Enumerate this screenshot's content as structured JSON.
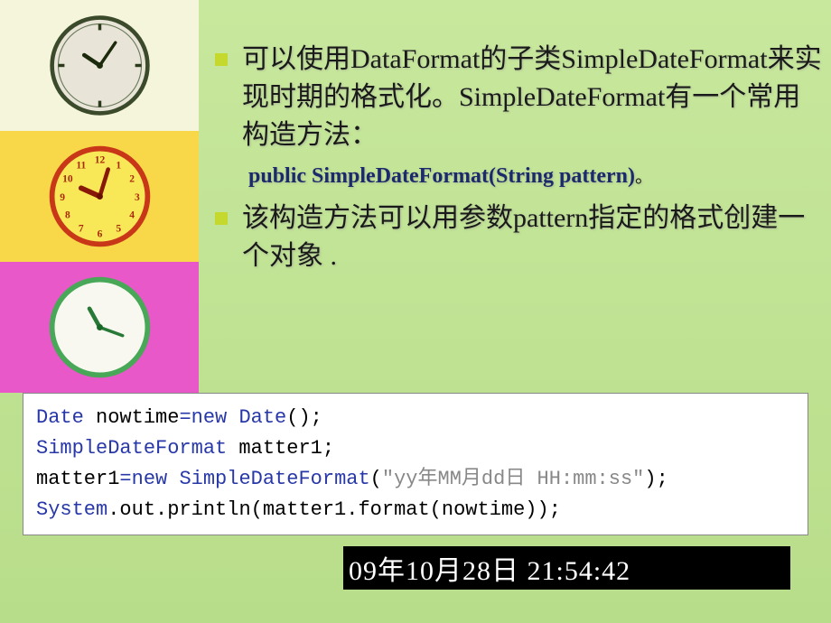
{
  "bullets": {
    "item1": "可以使用DataFormat的子类SimpleDateFormat来实现时期的格式化。SimpleDateFormat有一个常用构造方法：",
    "signature_main": "public SimpleDateFormat(String pattern)",
    "signature_suffix": "。",
    "item2": "该构造方法可以用参数pattern指定的格式创建一个对象 ."
  },
  "code": {
    "l1_t1": "Date",
    "l1_t2": " nowtime",
    "l1_t3": "=",
    "l1_t4": "new",
    "l1_t5": " ",
    "l1_t6": "Date",
    "l1_t7": "();",
    "l2_t1": "SimpleDateFormat",
    "l2_t2": " matter1;",
    "l3_t1": "matter1",
    "l3_t2": "=",
    "l3_t3": "new",
    "l3_t4": " ",
    "l3_t5": "SimpleDateFormat",
    "l3_t6": "(",
    "l3_t7": "\"yy",
    "l3_t8": "年",
    "l3_t9": "MM",
    "l3_t10": "月",
    "l3_t11": "dd",
    "l3_t12": "日",
    "l3_t13": " HH:mm:ss\"",
    "l3_t14": ");",
    "l4_t1": "System",
    "l4_t2": ".out.println(matter1.format(nowtime));"
  },
  "output": "09年10月28日 21:54:42"
}
